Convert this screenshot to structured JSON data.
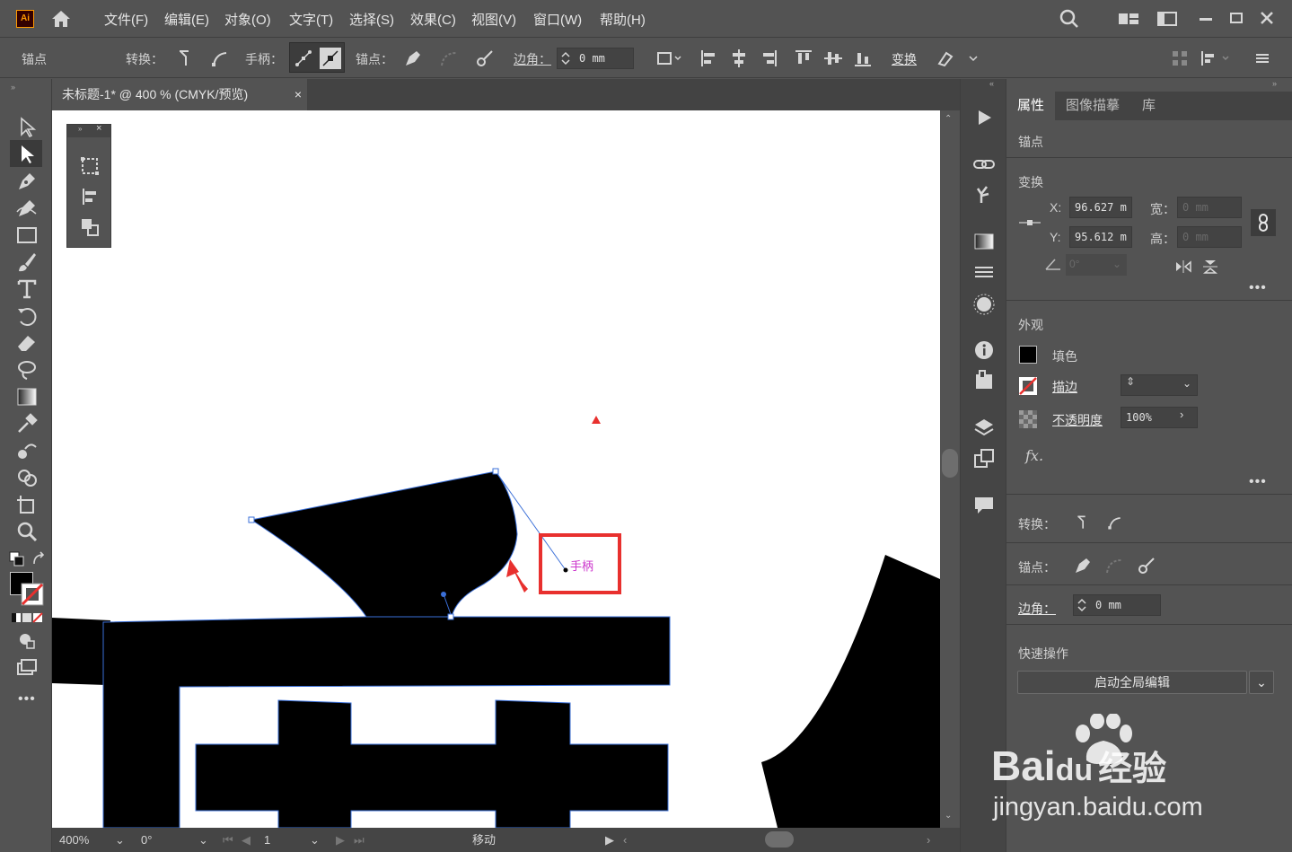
{
  "app": {
    "logo": "Ai"
  },
  "menu": [
    "文件(F)",
    "编辑(E)",
    "对象(O)",
    "文字(T)",
    "选择(S)",
    "效果(C)",
    "视图(V)",
    "窗口(W)",
    "帮助(H)"
  ],
  "control_bar": {
    "anchor_label": "锚点",
    "convert_label": "转换：",
    "handle_label": "手柄：",
    "anchor2_label": "锚点：",
    "corner_label": "边角：",
    "corner_value": "0 mm",
    "transform_label": "变换"
  },
  "document": {
    "tab_title": "未标题-1* @ 400 % (CMYK/预览)",
    "close": "×"
  },
  "canvas": {
    "annotation_label": "手柄"
  },
  "status_bar": {
    "zoom": "400%",
    "rotation": "0°",
    "artboard": "1",
    "action": "移动"
  },
  "properties_panel": {
    "tabs": [
      "属性",
      "图像描摹",
      "库"
    ],
    "selection_type": "锚点",
    "transform": {
      "title": "变换",
      "x_label": "X:",
      "x_value": "96.627 m",
      "y_label": "Y:",
      "y_value": "95.612 m",
      "w_label": "宽：",
      "w_value": "0 mm",
      "h_label": "高：",
      "h_value": "0 mm",
      "angle_value": "0°"
    },
    "appearance": {
      "title": "外观",
      "fill_label": "填色",
      "stroke_label": "描边",
      "opacity_label": "不透明度",
      "opacity_value": "100%",
      "fx_label": "fx."
    },
    "convert_label": "转换：",
    "anchor_label": "锚点：",
    "corner_label": "边角：",
    "corner_value": "0 mm",
    "quick_actions": {
      "title": "快速操作",
      "global_edit_button": "启动全局编辑"
    }
  },
  "watermark": {
    "brand": "Bai",
    "brand2": "du",
    "brand3": "经验",
    "url": "jingyan.baidu.com"
  },
  "colors": {
    "accent_red": "#e8302e",
    "path_blue": "#3a6fd8",
    "annotation_magenta": "#cc33cc"
  }
}
